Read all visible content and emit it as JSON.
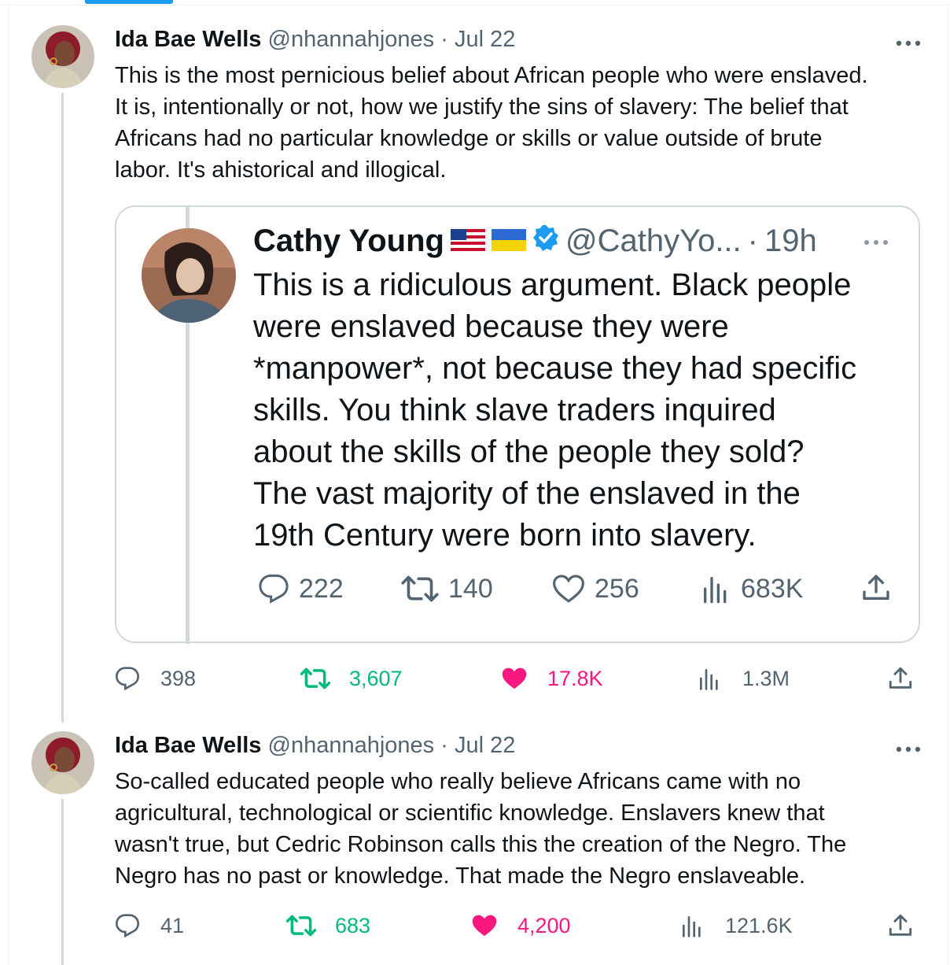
{
  "tweets": [
    {
      "author": {
        "name": "Ida Bae Wells",
        "handle": "@nhannahjones",
        "date": "Jul 22"
      },
      "text": "This is the most pernicious belief about African people who were enslaved.\nIt is, intentionally or not, how we justify the sins of slavery: The belief that\nAfricans had no particular knowledge or skills or value outside of brute\nlabor. It's ahistorical and illogical.",
      "quote": {
        "author": {
          "name": "Cathy Young",
          "handle": "@CathyYo...",
          "time": "19h"
        },
        "text": "This is a ridiculous argument. Black people\nwere enslaved because they were\n*manpower*, not because they had specific\nskills. You think slave traders inquired\nabout the skills of the people they sold?\nThe vast majority of the enslaved in the\n19th Century were born into slavery.",
        "stats": {
          "replies": "222",
          "retweets": "140",
          "likes": "256",
          "views": "683K"
        }
      },
      "stats": {
        "replies": "398",
        "retweets": "3,607",
        "likes": "17.8K",
        "views": "1.3M"
      }
    },
    {
      "author": {
        "name": "Ida Bae Wells",
        "handle": "@nhannahjones",
        "date": "Jul 22"
      },
      "text": "So-called educated people who really believe Africans came with no\nagricultural, technological or scientific knowledge. Enslavers knew that\nwasn't true, but Cedric Robinson calls this the creation of the Negro. The\nNegro has no past or knowledge. That made the Negro enslaveable.",
      "stats": {
        "replies": "41",
        "retweets": "683",
        "likes": "4,200",
        "views": "121.6K"
      }
    }
  ],
  "colors": {
    "retweeted": "#00ba7c",
    "liked": "#f91880",
    "muted": "#536471",
    "verified": "#1d9bf0"
  },
  "icons": [
    "reply-icon",
    "retweet-icon",
    "heart-icon",
    "views-icon",
    "share-icon",
    "more-icon",
    "verified-icon",
    "us-flag-icon",
    "ukraine-flag-icon"
  ]
}
